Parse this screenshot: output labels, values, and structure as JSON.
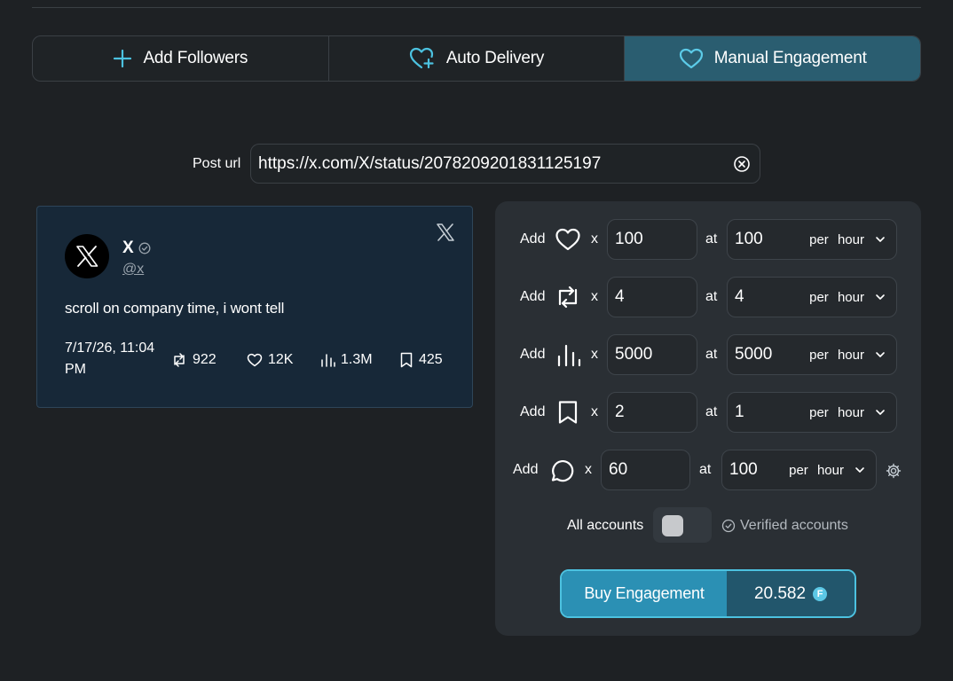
{
  "tabs": [
    {
      "label": "Add Followers",
      "icon": "plus-icon"
    },
    {
      "label": "Auto Delivery",
      "icon": "heart-plus-icon"
    },
    {
      "label": "Manual Engagement",
      "icon": "heart-icon",
      "active": true
    }
  ],
  "post": {
    "label": "Post url",
    "url": "https://x.com/X/status/2078209201831125197"
  },
  "tweet": {
    "name": "X",
    "handle": "@x",
    "text": "scroll on company time, i wont tell",
    "date": "7/17/26, 11:04 PM",
    "retweets": "922",
    "likes": "12K",
    "views": "1.3M",
    "bookmarks": "425"
  },
  "engagement": {
    "add_label": "Add",
    "x_label": "x",
    "at_label": "at",
    "per_label": "per",
    "unit_label": "hour",
    "rows": [
      {
        "icon": "heart-icon",
        "amount": "100",
        "rate": "100"
      },
      {
        "icon": "retweet-icon",
        "amount": "4",
        "rate": "4"
      },
      {
        "icon": "views-icon",
        "amount": "5000",
        "rate": "5000"
      },
      {
        "icon": "bookmark-icon",
        "amount": "2",
        "rate": "1"
      },
      {
        "icon": "comment-icon",
        "amount": "60",
        "rate": "100"
      }
    ]
  },
  "accounts": {
    "all_label": "All accounts",
    "verified_label": "Verified accounts"
  },
  "buy": {
    "label": "Buy Engagement",
    "price": "20.582",
    "coin_symbol": "F"
  },
  "colors": {
    "background": "#1e2124",
    "panel": "#2a2f34",
    "accent": "#4cc2e0",
    "active_tab": "#2a5d70"
  }
}
